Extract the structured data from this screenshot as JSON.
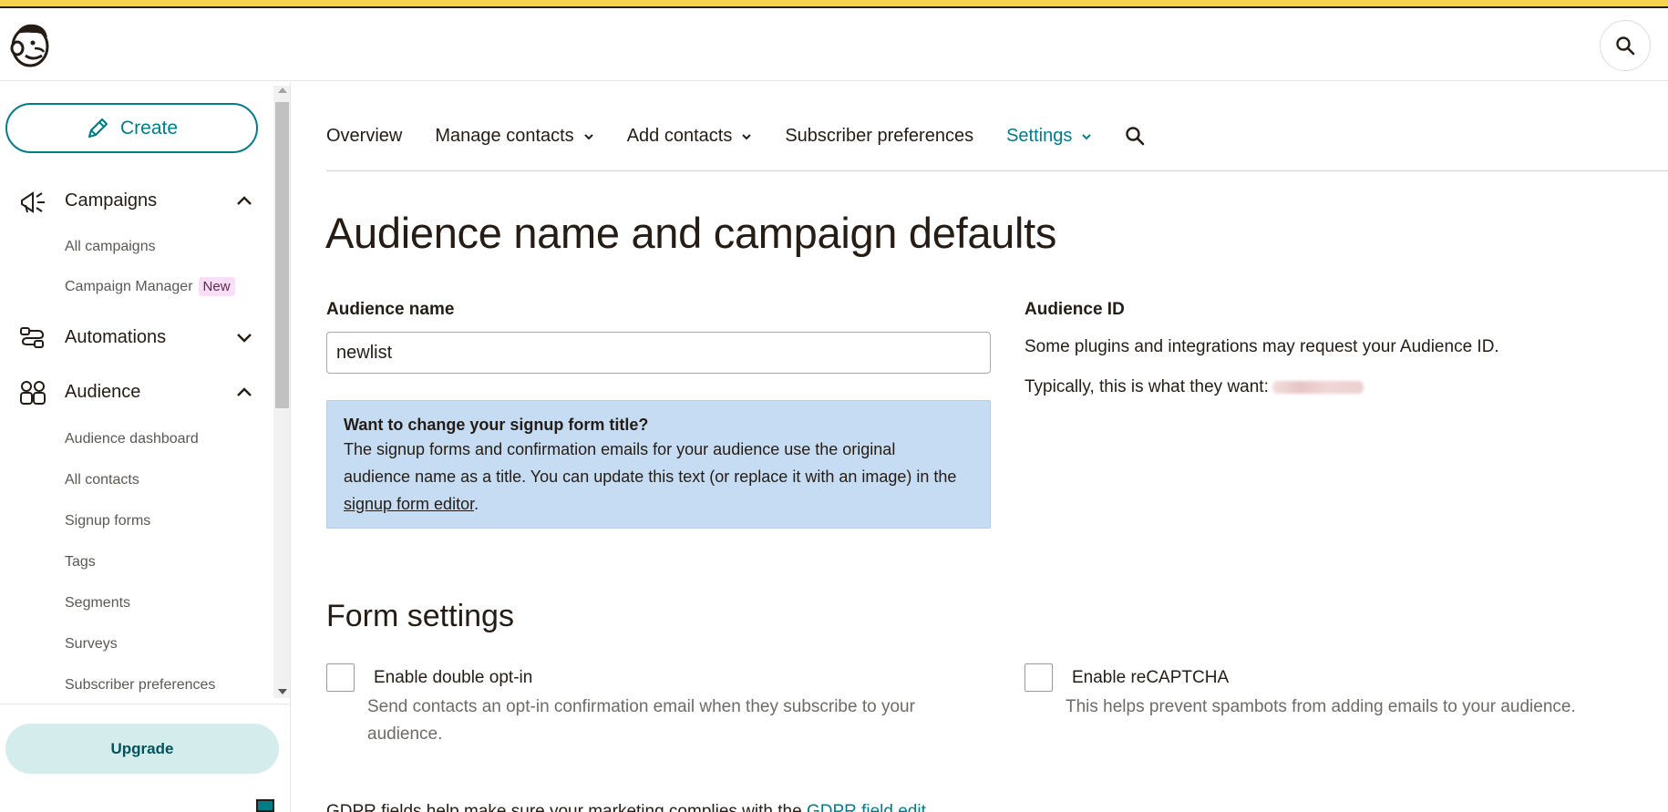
{
  "header": {
    "logo_icon": "freddie-logo-icon",
    "search_icon": "search-icon"
  },
  "sidebar": {
    "create_label": "Create",
    "sections": [
      {
        "label": "Campaigns",
        "icon": "megaphone-icon",
        "expanded": true,
        "items": [
          {
            "label": "All campaigns"
          },
          {
            "label": "Campaign Manager",
            "badge": "New"
          }
        ]
      },
      {
        "label": "Automations",
        "icon": "automation-flow-icon",
        "expanded": false,
        "items": []
      },
      {
        "label": "Audience",
        "icon": "audience-people-icon",
        "expanded": true,
        "items": [
          {
            "label": "Audience dashboard"
          },
          {
            "label": "All contacts"
          },
          {
            "label": "Signup forms"
          },
          {
            "label": "Tags"
          },
          {
            "label": "Segments"
          },
          {
            "label": "Surveys"
          },
          {
            "label": "Subscriber preferences"
          }
        ]
      }
    ],
    "upgrade_label": "Upgrade"
  },
  "tabs": [
    {
      "label": "Overview",
      "dropdown": false,
      "active": false
    },
    {
      "label": "Manage contacts",
      "dropdown": true,
      "active": false
    },
    {
      "label": "Add contacts",
      "dropdown": true,
      "active": false
    },
    {
      "label": "Subscriber preferences",
      "dropdown": false,
      "active": false
    },
    {
      "label": "Settings",
      "dropdown": true,
      "active": true
    }
  ],
  "page": {
    "title": "Audience name and campaign defaults",
    "audience_name": {
      "label": "Audience name",
      "value": "newlist"
    },
    "info_box": {
      "title": "Want to change your signup form title?",
      "body_line1": "The signup forms and confirmation emails for your audience use the original",
      "body_line2": "audience name as a title. You can update this text (or replace it with an image) in the",
      "link_text": "signup form editor",
      "after_link": "."
    },
    "audience_id": {
      "label": "Audience ID",
      "line1": "Some plugins and integrations may request your Audience ID.",
      "line2": "Typically, this is what they want:"
    },
    "form_settings": {
      "title": "Form settings",
      "double_optin": {
        "label": "Enable double opt-in",
        "help_line1": "Send contacts an opt-in confirmation email when they subscribe to your",
        "help_line2": "audience.",
        "checked": false
      },
      "recaptcha": {
        "label": "Enable reCAPTCHA",
        "help": "This helps prevent spambots from adding emails to your audience.",
        "checked": false
      }
    },
    "cut_line": {
      "text": "GDPR fields help make sure your marketing complies with the",
      "link": "GDPR field edit"
    }
  },
  "colors": {
    "accent": "#007c89",
    "top_stripe": "#f7d54a",
    "info_box_bg": "#c6dcf2",
    "upgrade_bg": "#d5ecec",
    "badge_bg": "#f8dff5"
  }
}
